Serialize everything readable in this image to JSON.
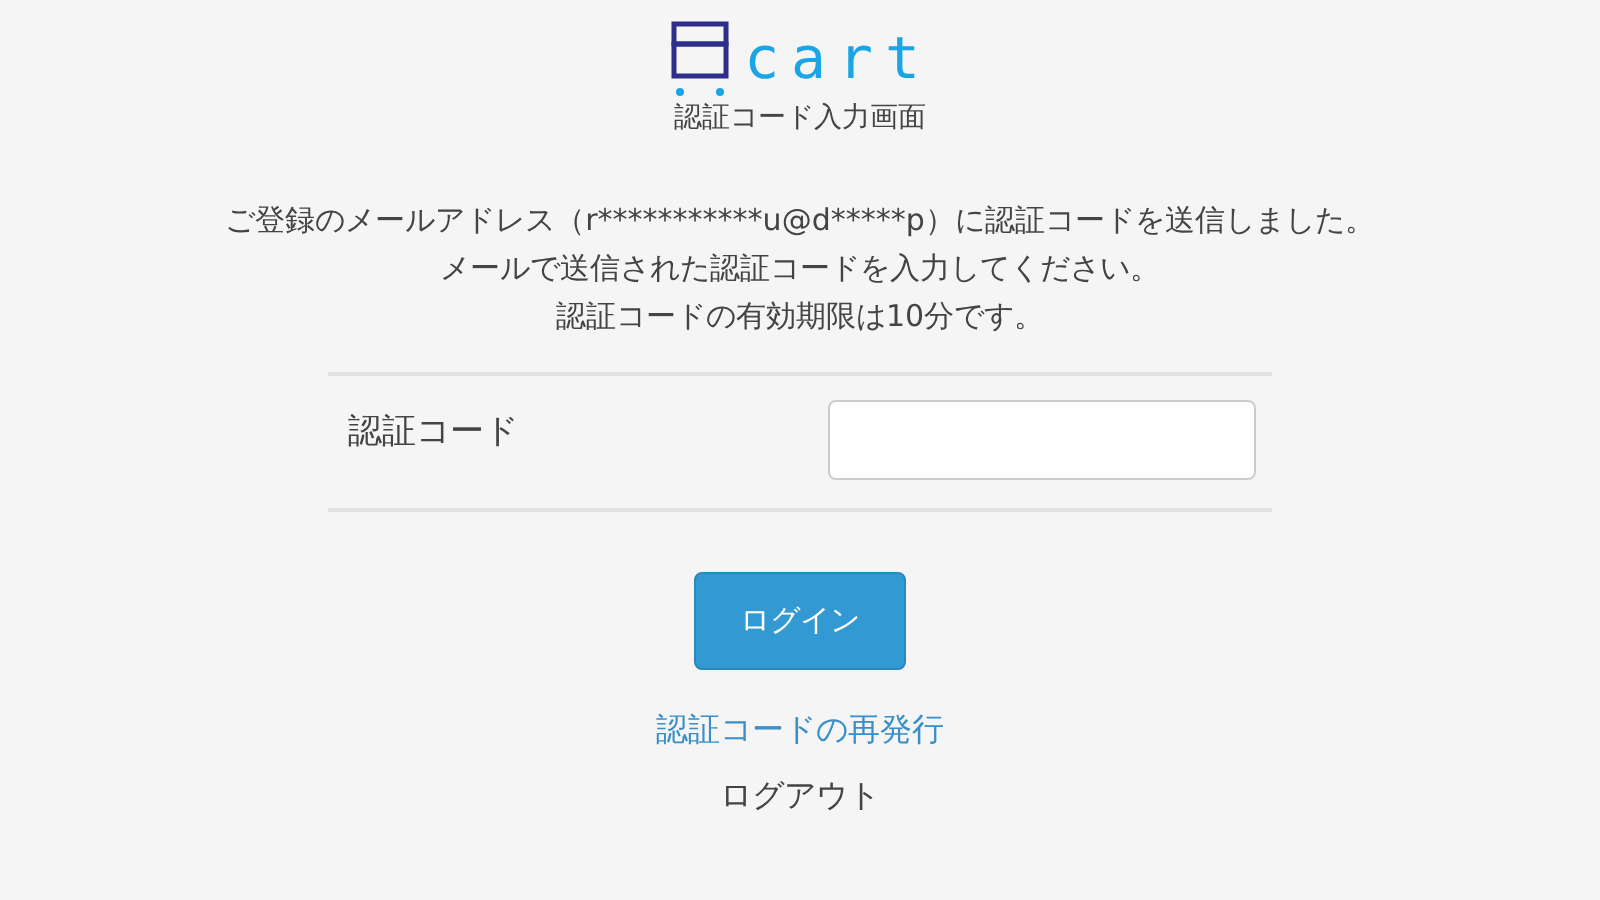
{
  "logo": {
    "text": "cart"
  },
  "title": "認証コード入力画面",
  "message": [
    "ご登録のメールアドレス（r***********u@d*****p）に認証コードを送信しました。",
    "メールで送信された認証コードを入力してください。",
    "認証コードの有効期限は10分です。"
  ],
  "form": {
    "label": "認証コード"
  },
  "login_button": "ログイン",
  "resend_link": "認証コードの再発行",
  "logout_link": "ログアウト"
}
